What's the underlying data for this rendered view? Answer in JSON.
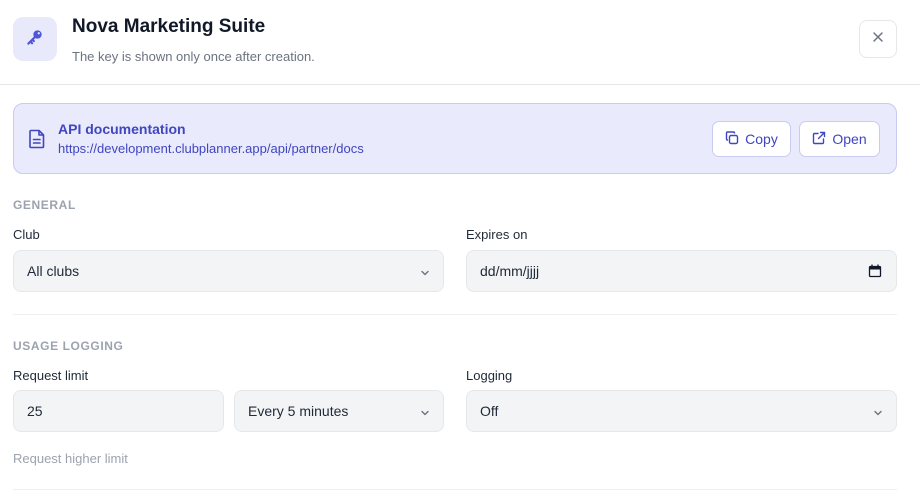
{
  "header": {
    "title": "Nova Marketing Suite",
    "subtitle": "The key is shown only once after creation.",
    "key_icon": "key-icon",
    "close_icon": "close-icon"
  },
  "docs": {
    "title": "API documentation",
    "url": "https://development.clubplanner.app/api/partner/docs",
    "copy_label": "Copy",
    "open_label": "Open",
    "icon": "document-icon"
  },
  "general": {
    "section_label": "GENERAL",
    "club_label": "Club",
    "club_value": "All clubs",
    "expires_label": "Expires on",
    "expires_value": "dd/mm/jjjj"
  },
  "usage": {
    "section_label": "USAGE LOGGING",
    "request_limit_label": "Request limit",
    "request_limit_value": "25",
    "interval_value": "Every 5 minutes",
    "logging_label": "Logging",
    "logging_value": "Off",
    "request_higher_label": "Request higher limit"
  },
  "colors": {
    "accent": "#4046c0",
    "accent_bg": "#e9eafb",
    "muted": "#9ca3af"
  }
}
